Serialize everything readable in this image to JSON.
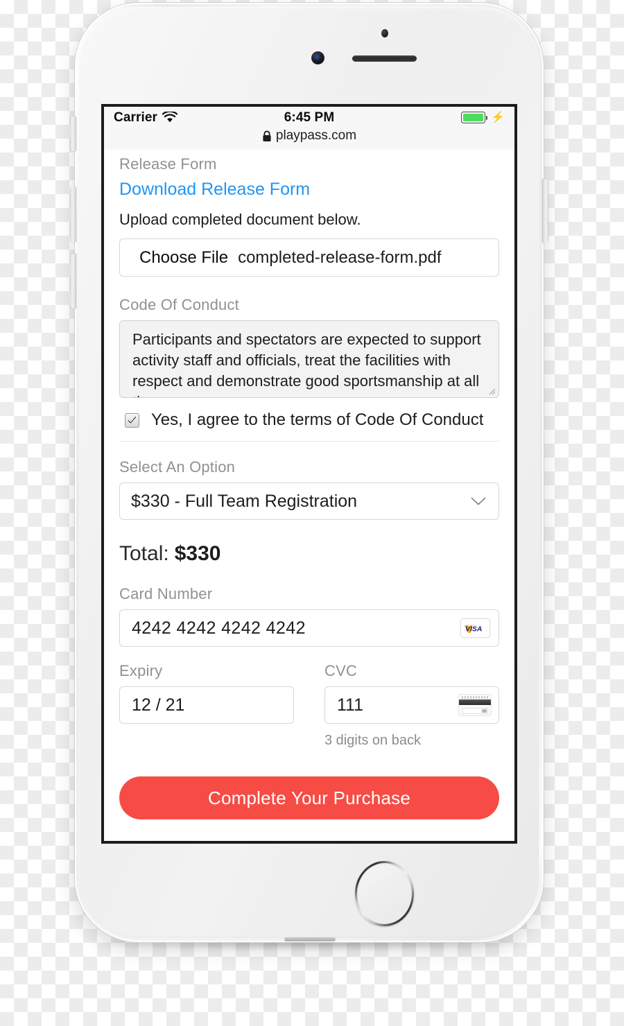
{
  "status_bar": {
    "carrier": "Carrier",
    "wifi_icon": "wifi-icon",
    "time": "6:45 PM",
    "battery_icon": "battery-full-icon",
    "charging_icon": "⚡"
  },
  "browser": {
    "lock_icon": "lock-icon",
    "url": "playpass.com"
  },
  "form": {
    "release_form": {
      "section_label": "Release Form",
      "download_link": "Download Release Form",
      "upload_instruction": "Upload completed document below.",
      "choose_file_button": "Choose File",
      "chosen_file_name": "completed-release-form.pdf"
    },
    "code_of_conduct": {
      "section_label": "Code Of Conduct",
      "body_text": "Participants and spectators are expected to support activity staff and officials, treat the facilities with respect and demonstrate good sportsmanship at all times.",
      "agree_checkbox_checked": "checked",
      "agree_label": "Yes, I agree to the terms of Code Of Conduct",
      "resize_grip_icon": "resize-grip-icon"
    },
    "option": {
      "section_label": "Select An Option",
      "selected_value": "$330 - Full Team Registration",
      "chevron_icon": "chevron-down-icon"
    },
    "total": {
      "label": "Total:",
      "amount": "$330"
    },
    "card_number": {
      "label": "Card Number",
      "value": "4242 4242 4242 4242",
      "brand_icon": "visa-icon",
      "brand_text": "VISA"
    },
    "expiry": {
      "label": "Expiry",
      "value": "12 / 21"
    },
    "cvc": {
      "label": "CVC",
      "value": "111",
      "hint": "3 digits on back",
      "card_back_icon": "card-back-icon"
    },
    "submit_button": "Complete Your Purchase"
  },
  "colors": {
    "accent_red": "#f74b45",
    "link_blue": "#2196f3",
    "label_gray": "#919191",
    "battery_green": "#4ddd5e",
    "visa_blue": "#1a1f71",
    "visa_orange": "#f7a600"
  }
}
